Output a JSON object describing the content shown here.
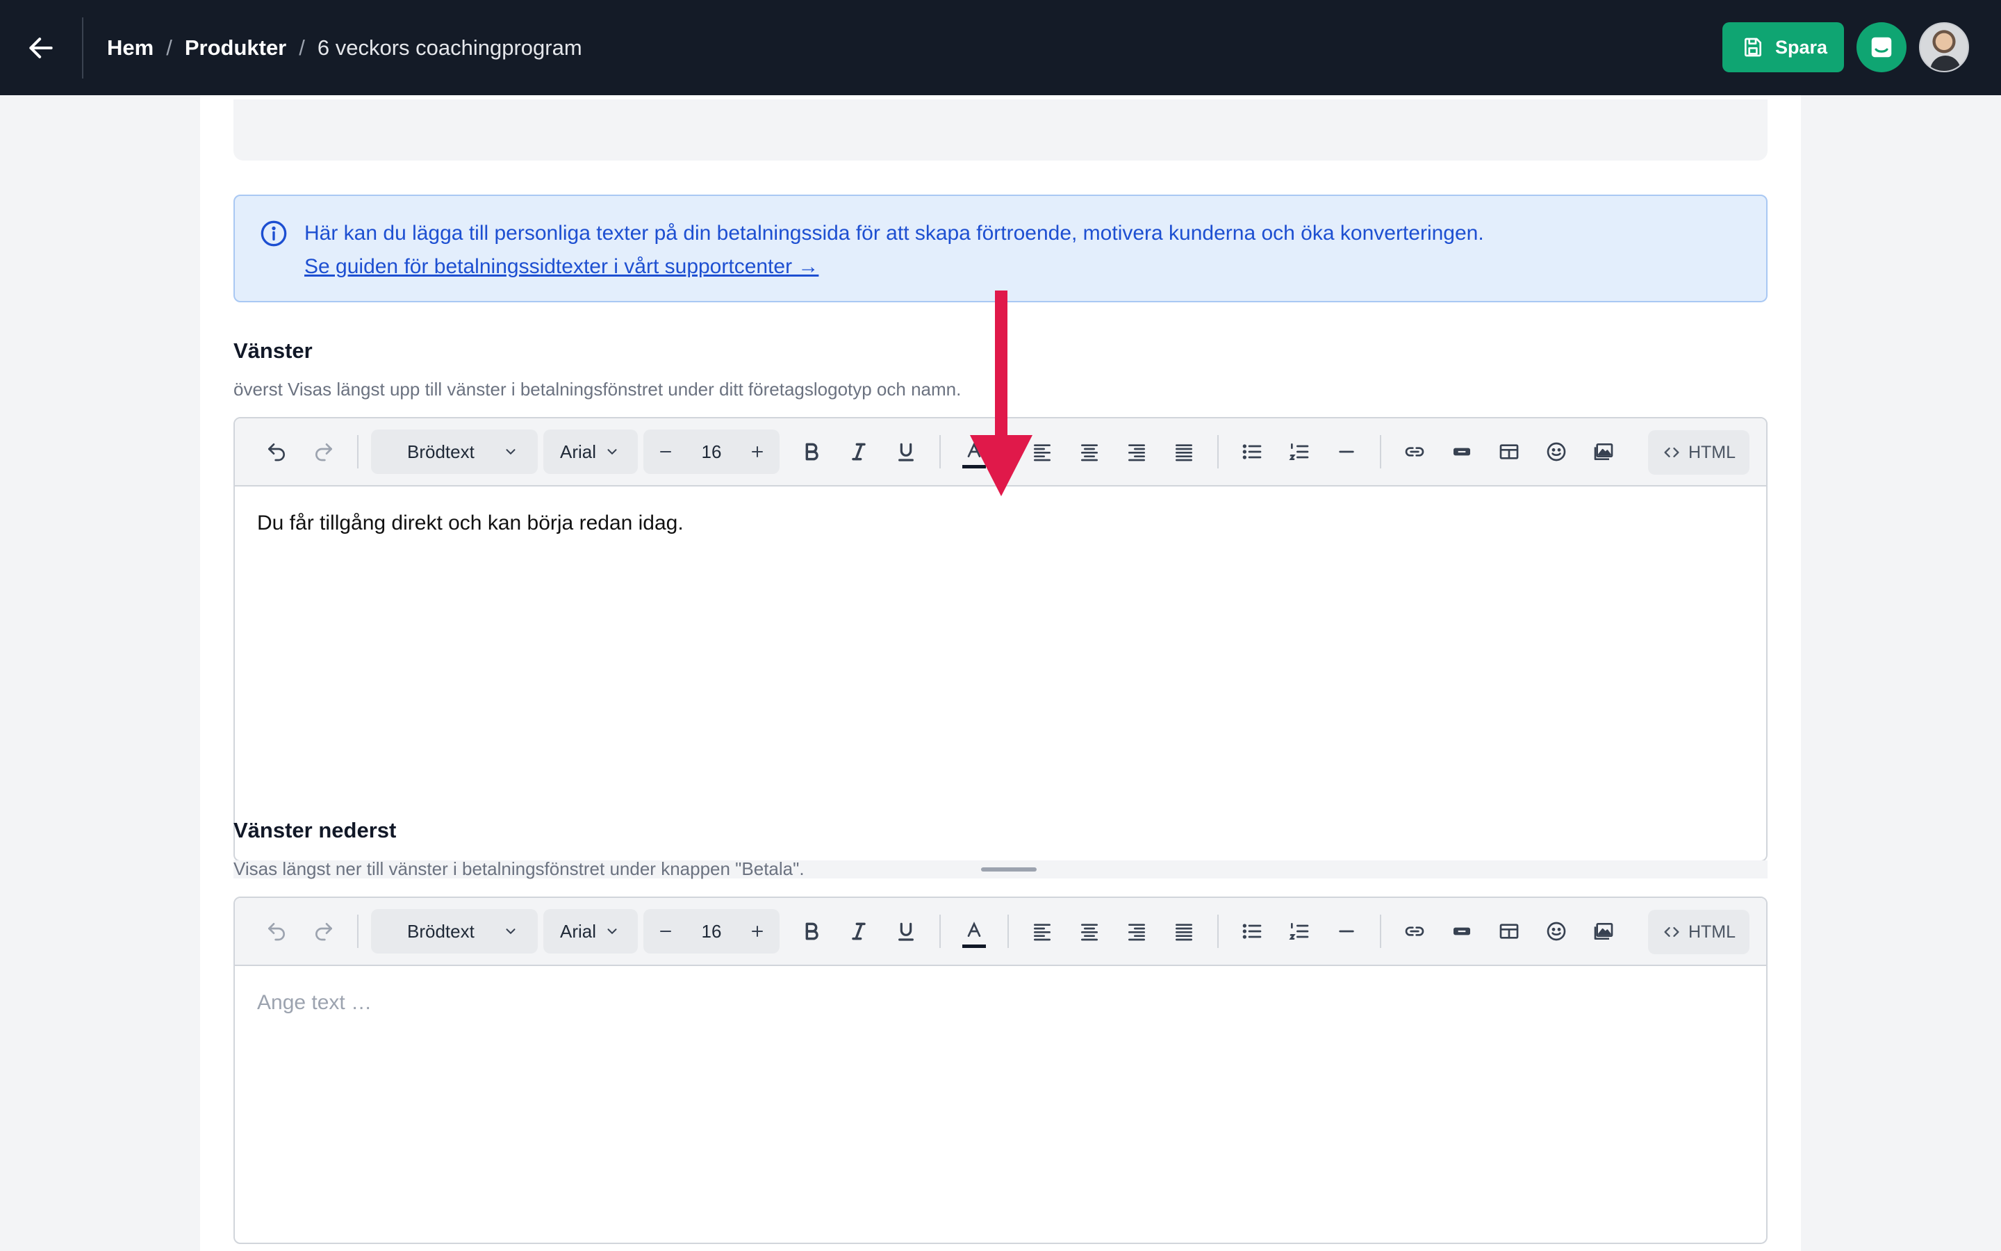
{
  "header": {
    "breadcrumb": {
      "home": "Hem",
      "products": "Produkter",
      "current": "6 veckors coachingprogram",
      "separator": "/"
    },
    "save_label": "Spara"
  },
  "info": {
    "text": "Här kan du lägga till personliga texter på din betalningssida för att skapa förtroende, motivera kunderna och öka konverteringen.",
    "link": "Se guiden för betalningssidtexter i vårt supportcenter →"
  },
  "fields": [
    {
      "title": "Vänster",
      "description": "överst Visas längst upp till vänster i betalningsfönstret under ditt företagslogotyp och namn.",
      "toolbar": {
        "style": "Brödtext",
        "font": "Arial",
        "size": "16",
        "html_label": "HTML"
      },
      "content": "Du får tillgång direkt och kan börja redan idag."
    },
    {
      "title": "Vänster nederst",
      "description": "Visas längst ner till vänster i betalningsfönstret under knappen \"Betala\".",
      "toolbar": {
        "style": "Brödtext",
        "font": "Arial",
        "size": "16",
        "html_label": "HTML"
      },
      "placeholder": "Ange text …"
    }
  ],
  "colors": {
    "topbar": "#141b27",
    "accent": "#0fa572",
    "info_bg": "#e3eefc",
    "info_text": "#1d4fd1",
    "annotation_arrow": "#e0194a"
  }
}
